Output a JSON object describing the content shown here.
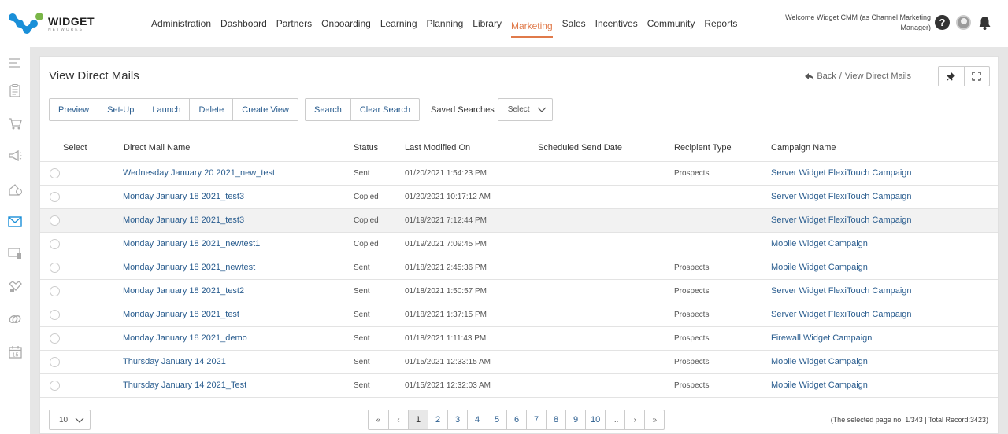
{
  "brand": {
    "name": "WIDGET",
    "sub": "NETWORKS"
  },
  "nav": [
    "Administration",
    "Dashboard",
    "Partners",
    "Onboarding",
    "Learning",
    "Planning",
    "Library",
    "Marketing",
    "Sales",
    "Incentives",
    "Community",
    "Reports"
  ],
  "nav_active": "Marketing",
  "user": {
    "welcome": "Welcome Widget CMM (as Channel Marketing Manager)"
  },
  "sidebar_icons": [
    "menu-icon",
    "clipboard-icon",
    "cart-icon",
    "megaphone-icon",
    "gift-icon",
    "mail-icon",
    "monitor-icon",
    "handshake-icon",
    "link-icon",
    "calendar-icon"
  ],
  "page": {
    "title": "View Direct Mails",
    "back_label": "Back",
    "separator": "/",
    "breadcrumb_current": "View Direct Mails"
  },
  "toolbar": {
    "preview": "Preview",
    "setup": "Set-Up",
    "launch": "Launch",
    "delete": "Delete",
    "create_view": "Create View",
    "search": "Search",
    "clear_search": "Clear Search",
    "saved_searches": "Saved Searches",
    "saved_select": "Select"
  },
  "table": {
    "columns": [
      "Select",
      "Direct Mail Name",
      "Status",
      "Last Modified On",
      "Scheduled Send Date",
      "Recipient Type",
      "Campaign Name"
    ],
    "rows": [
      {
        "name": "Wednesday January 20 2021_new_test",
        "status": "Sent",
        "modified": "01/20/2021 1:54:23 PM",
        "scheduled": "",
        "recipient": "Prospects",
        "campaign": "Server Widget FlexiTouch Campaign"
      },
      {
        "name": "Monday January 18 2021_test3",
        "status": "Copied",
        "modified": "01/20/2021 10:17:12 AM",
        "scheduled": "",
        "recipient": "",
        "campaign": "Server Widget FlexiTouch Campaign"
      },
      {
        "name": "Monday January 18 2021_test3",
        "status": "Copied",
        "modified": "01/19/2021 7:12:44 PM",
        "scheduled": "",
        "recipient": "",
        "campaign": "Server Widget FlexiTouch Campaign"
      },
      {
        "name": "Monday January 18 2021_newtest1",
        "status": "Copied",
        "modified": "01/19/2021 7:09:45 PM",
        "scheduled": "",
        "recipient": "",
        "campaign": "Mobile Widget Campaign"
      },
      {
        "name": "Monday January 18 2021_newtest",
        "status": "Sent",
        "modified": "01/18/2021 2:45:36 PM",
        "scheduled": "",
        "recipient": "Prospects",
        "campaign": "Mobile Widget Campaign"
      },
      {
        "name": "Monday January 18 2021_test2",
        "status": "Sent",
        "modified": "01/18/2021 1:50:57 PM",
        "scheduled": "",
        "recipient": "Prospects",
        "campaign": "Server Widget FlexiTouch Campaign"
      },
      {
        "name": "Monday January 18 2021_test",
        "status": "Sent",
        "modified": "01/18/2021 1:37:15 PM",
        "scheduled": "",
        "recipient": "Prospects",
        "campaign": "Server Widget FlexiTouch Campaign"
      },
      {
        "name": "Monday January 18 2021_demo",
        "status": "Sent",
        "modified": "01/18/2021 1:11:43 PM",
        "scheduled": "",
        "recipient": "Prospects",
        "campaign": "Firewall Widget Campaign"
      },
      {
        "name": "Thursday January 14 2021",
        "status": "Sent",
        "modified": "01/15/2021 12:33:15 AM",
        "scheduled": "",
        "recipient": "Prospects",
        "campaign": "Mobile Widget Campaign"
      },
      {
        "name": "Thursday January 14 2021_Test",
        "status": "Sent",
        "modified": "01/15/2021 12:32:03 AM",
        "scheduled": "",
        "recipient": "Prospects",
        "campaign": "Mobile Widget Campaign"
      }
    ]
  },
  "footer": {
    "page_size": "10",
    "pages": [
      "«",
      "‹",
      "1",
      "2",
      "3",
      "4",
      "5",
      "6",
      "7",
      "8",
      "9",
      "10",
      "...",
      "›",
      "»"
    ],
    "active_page": "1",
    "record_info": "(The selected page no: 1/343 | Total Record:3423)"
  },
  "colors": {
    "accent": "#e07a4a",
    "link": "#2a5d8f",
    "logo_blue": "#1a8fd8",
    "logo_green": "#7ab648"
  }
}
